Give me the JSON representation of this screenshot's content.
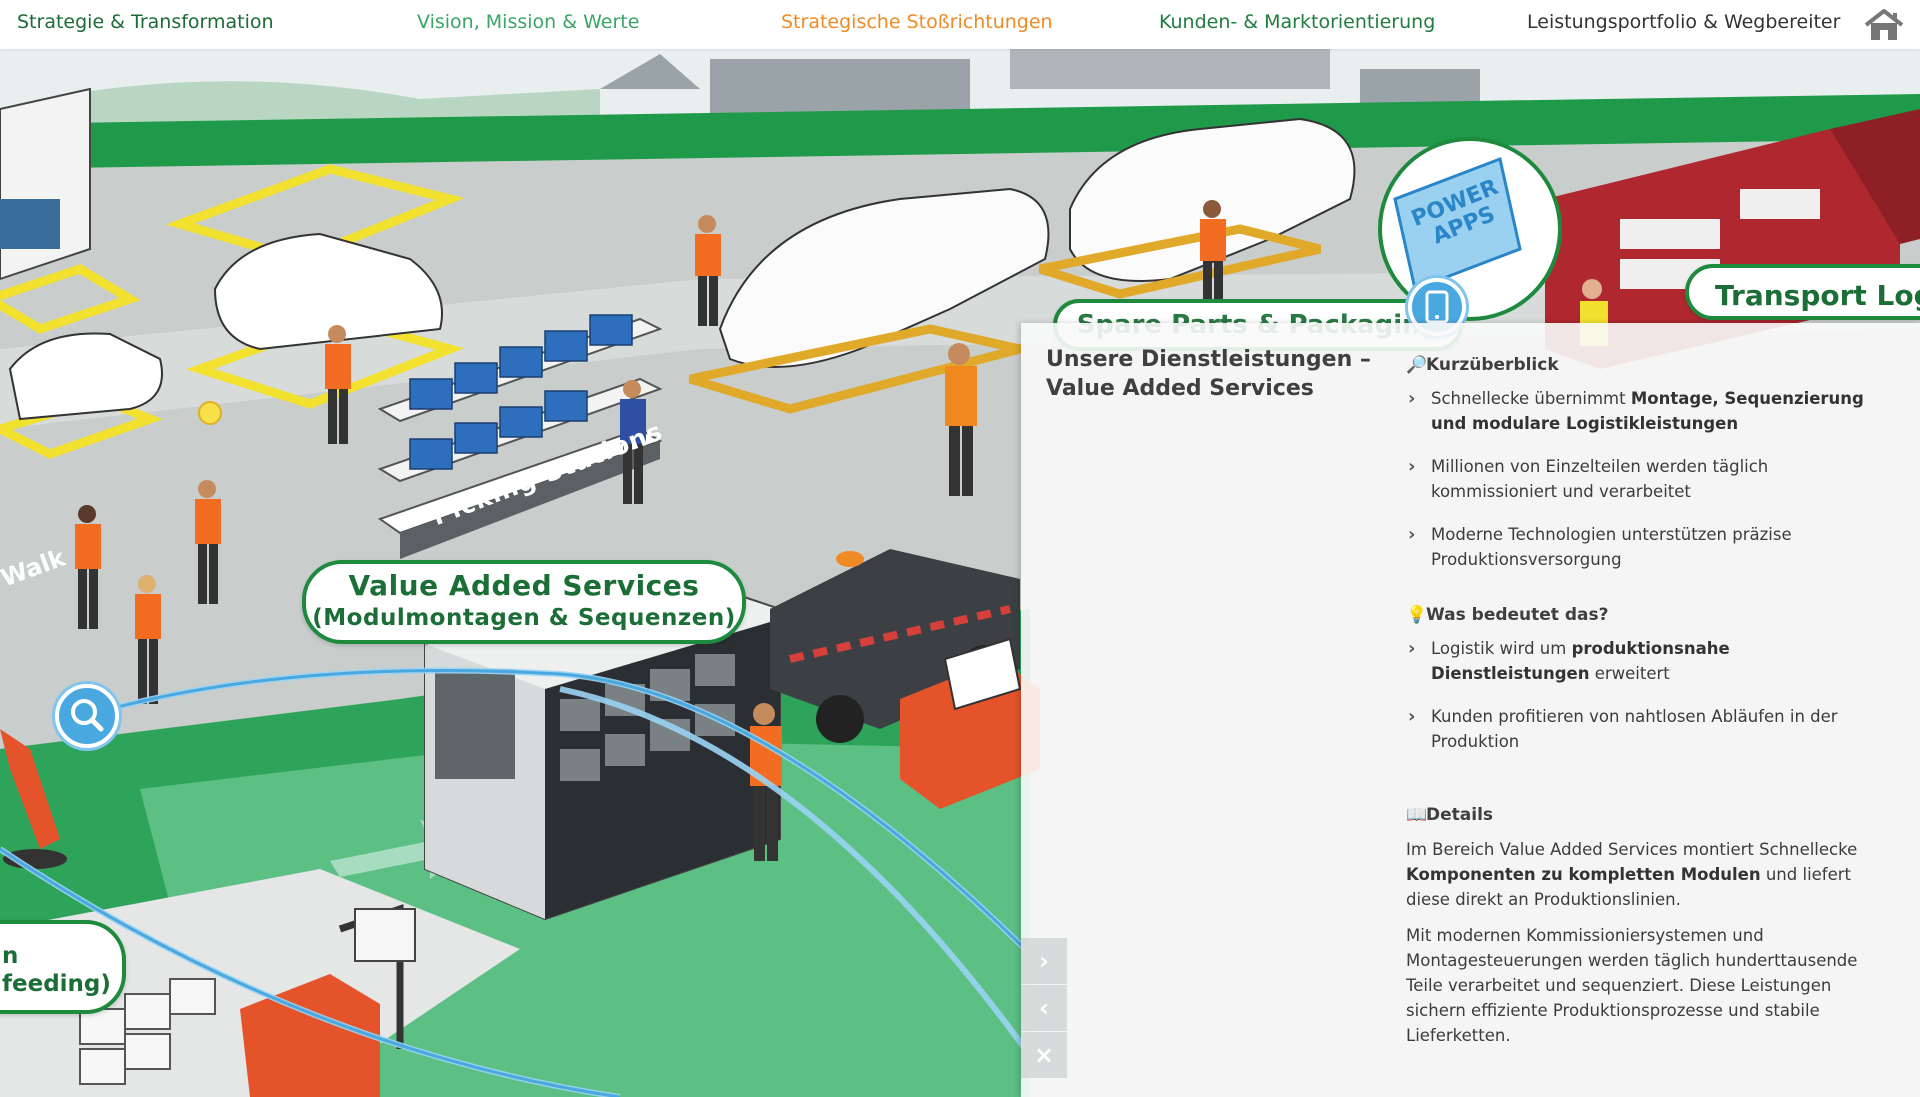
{
  "nav": {
    "items": [
      {
        "label": "Strategie & Transformation",
        "color": "#1a6b34"
      },
      {
        "label": "Vision, Mission & Werte",
        "color": "#3aa565"
      },
      {
        "label": "Strategische Stoßrichtungen",
        "color": "#f08a24"
      },
      {
        "label": "Kunden- & Marktorientierung",
        "color": "#1f7d3e"
      },
      {
        "label": "Leistungsportfolio & Wegbereiter",
        "color": "#333333"
      }
    ],
    "home_icon": "home-icon"
  },
  "scene": {
    "vas_label_line1": "Value Added Services",
    "vas_label_line2": "(Modulmontagen & Sequenzen)",
    "transport_label": "Transport Logi",
    "spare_label": "Spare Parts & Packaging",
    "left_label_line1": "n",
    "left_label_line2": "feeding)",
    "picking_text": "Picking Stations",
    "walk_text": "Walk",
    "power_apps_line1": "POWER",
    "power_apps_line2": "APPS"
  },
  "panel": {
    "title": "Unsere Dienstleistungen – Value Added Services",
    "sections": {
      "overview": {
        "icon": "🔎",
        "heading": "Kurzüberblick",
        "bullets": [
          {
            "pre": "Schnellecke übernimmt ",
            "bold": "Montage, Sequenzierung und modulare Logistikleistungen",
            "post": ""
          },
          {
            "pre": "Millionen von Einzelteilen werden täglich kommissioniert und verarbeitet",
            "bold": "",
            "post": ""
          },
          {
            "pre": "Moderne Technologien unterstützen präzise Produktionsversorgung",
            "bold": "",
            "post": ""
          }
        ]
      },
      "meaning": {
        "icon": "💡",
        "heading": "Was bedeutet das?",
        "bullets": [
          {
            "pre": "Logistik wird um ",
            "bold": "produktionsnahe Dienstleistungen",
            "post": " erweitert"
          },
          {
            "pre": "Kunden profitieren von nahtlosen Abläufen in der Produktion",
            "bold": "",
            "post": ""
          }
        ]
      },
      "details": {
        "icon": "📖",
        "heading": "Details",
        "para1_pre": "Im Bereich Value Added Services montiert Schnellecke ",
        "para1_bold": "Komponenten zu kompletten Modulen",
        "para1_post": " und liefert diese direkt an Produktionslinien.",
        "para2": "Mit modernen Kommissioniersystemen und Montagesteuerungen werden täglich hunderttausende Teile verarbeitet und sequenziert. Diese Leistungen sichern effiziente Produktionsprozesse und stabile Lieferketten."
      }
    },
    "controls": {
      "next": "›",
      "prev": "‹",
      "close": "×"
    }
  },
  "colors": {
    "brand_green": "#1e8a3e",
    "accent_orange": "#f08a24",
    "accent_blue": "#4aa8e0"
  }
}
